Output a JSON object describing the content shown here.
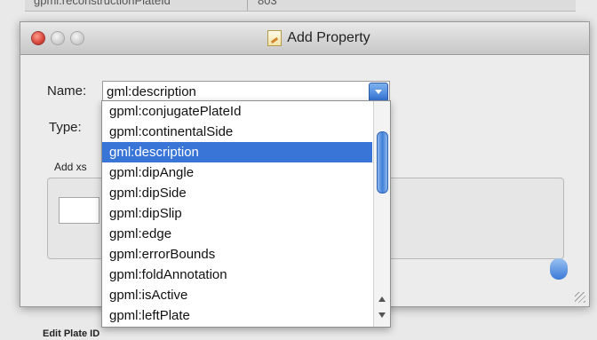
{
  "background": {
    "row_left": "gpml:reconstructionPlateId",
    "row_right": "803",
    "footer_label": "Edit Plate ID"
  },
  "dialog": {
    "title": "Add Property",
    "name_label": "Name:",
    "name_value": "gml:description",
    "type_label": "Type:",
    "add_xs_label": "Add xs"
  },
  "dropdown": {
    "items": [
      "gpml:conjugatePlateId",
      "gpml:continentalSide",
      "gml:description",
      "gpml:dipAngle",
      "gpml:dipSide",
      "gpml:dipSlip",
      "gpml:edge",
      "gpml:errorBounds",
      "gpml:foldAnnotation",
      "gpml:isActive",
      "gpml:leftPlate"
    ],
    "selected_index": 2
  },
  "colors": {
    "selection": "#3875d7",
    "window_bg": "#ececec",
    "close_button": "#d8463a"
  }
}
